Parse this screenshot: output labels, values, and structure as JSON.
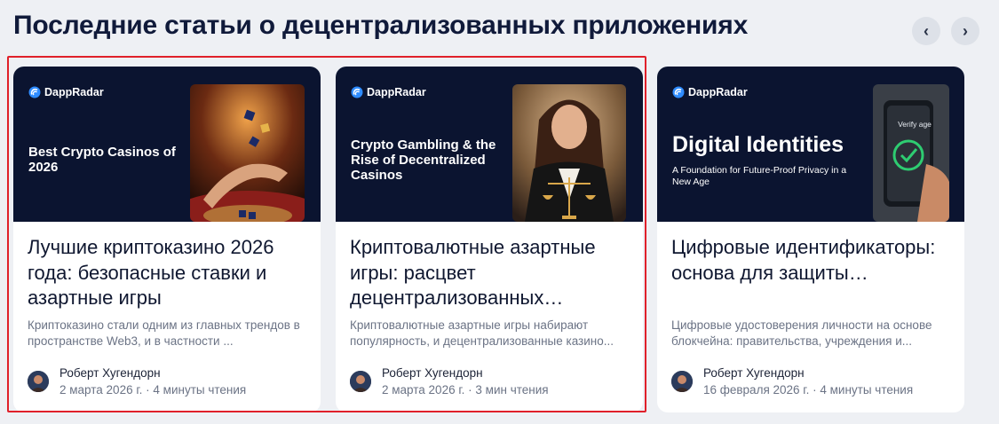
{
  "section": {
    "title": "Последние статьи о децентрализованных приложениях",
    "prev_icon": "chevron-left-icon",
    "next_icon": "chevron-right-icon",
    "prev_glyph": "‹",
    "next_glyph": "›"
  },
  "articles": [
    {
      "brand": "DappRadar",
      "banner_headline": "Best Crypto Casinos of 2026",
      "banner_sub": "",
      "photo_caption": "",
      "title": "Лучшие криптоказино 2026 года: безопасные ставки и азартные игры",
      "excerpt": "Криптоказино стали одним из главных трендов в пространстве Web3, и в частности ...",
      "author": "Роберт Хугендорн",
      "date": "2 марта 2026 г.",
      "read_time": "4 минуты чтения"
    },
    {
      "brand": "DappRadar",
      "banner_headline": "Crypto Gambling & the Rise of Decentralized Casinos",
      "banner_sub": "",
      "photo_caption": "",
      "title": "Криптовалютные азартные игры: расцвет децентрализованных…",
      "excerpt": "Криптовалютные азартные игры набирают популярность, и децентрализованные казино...",
      "author": "Роберт Хугендорн",
      "date": "2 марта 2026 г.",
      "read_time": "3 мин чтения"
    },
    {
      "brand": "DappRadar",
      "banner_headline": "Digital Identities",
      "banner_sub": "A Foundation for Future-Proof Privacy in a New Age",
      "photo_caption": "Verify age",
      "title": "Цифровые идентификаторы: основа для защиты…",
      "excerpt": "Цифровые удостоверения личности на основе блокчейна: правительства, учреждения и...",
      "author": "Роберт Хугендорн",
      "date": "16 февраля 2026 г.",
      "read_time": "4 минуты чтения"
    }
  ],
  "meta_separator": "·",
  "colors": {
    "page_bg": "#eef0f4",
    "banner_bg": "#0b1430",
    "highlight_border": "#e0202a",
    "brand_accent": "#2f8cff",
    "check_green": "#2ecc71"
  }
}
